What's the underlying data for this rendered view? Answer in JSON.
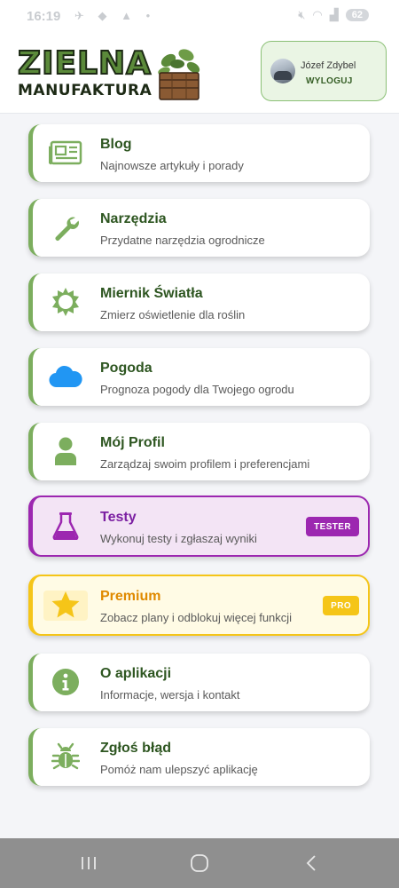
{
  "status_bar": {
    "time": "16:19",
    "battery": "62"
  },
  "header": {
    "logo": {
      "line1": "ZIELNA",
      "line2": "MANUFAKTURA"
    },
    "user": {
      "name": "Józef Zdybel",
      "logout_label": "WYLOGUJ"
    }
  },
  "menu": {
    "items": [
      {
        "title": "Blog",
        "description": "Najnowsze artykuły i porady",
        "icon": "newspaper-icon"
      },
      {
        "title": "Narzędzia",
        "description": "Przydatne narzędzia ogrodnicze",
        "icon": "wrench-icon"
      },
      {
        "title": "Miernik Światła",
        "description": "Zmierz oświetlenie dla roślin",
        "icon": "sun-icon"
      },
      {
        "title": "Pogoda",
        "description": "Prognoza pogody dla Twojego ogrodu",
        "icon": "cloud-icon"
      },
      {
        "title": "Mój Profil",
        "description": "Zarządzaj swoim profilem i preferencjami",
        "icon": "user-icon"
      },
      {
        "title": "Testy",
        "description": "Wykonuj testy i zgłaszaj wyniki",
        "icon": "flask-icon",
        "badge": "TESTER"
      },
      {
        "title": "Premium",
        "description": "Zobacz plany i odblokuj więcej funkcji",
        "icon": "star-icon",
        "badge": "PRO"
      },
      {
        "title": "O aplikacji",
        "description": "Informacje, wersja i kontakt",
        "icon": "info-icon"
      },
      {
        "title": "Zgłoś błąd",
        "description": "Pomóż nam ulepszyć aplikację",
        "icon": "bug-icon"
      }
    ]
  },
  "colors": {
    "accent_green": "#7cae5e",
    "title_green": "#2e5621",
    "tester_purple": "#9c27b0",
    "premium_yellow": "#f5c518",
    "weather_blue": "#2196f3"
  }
}
